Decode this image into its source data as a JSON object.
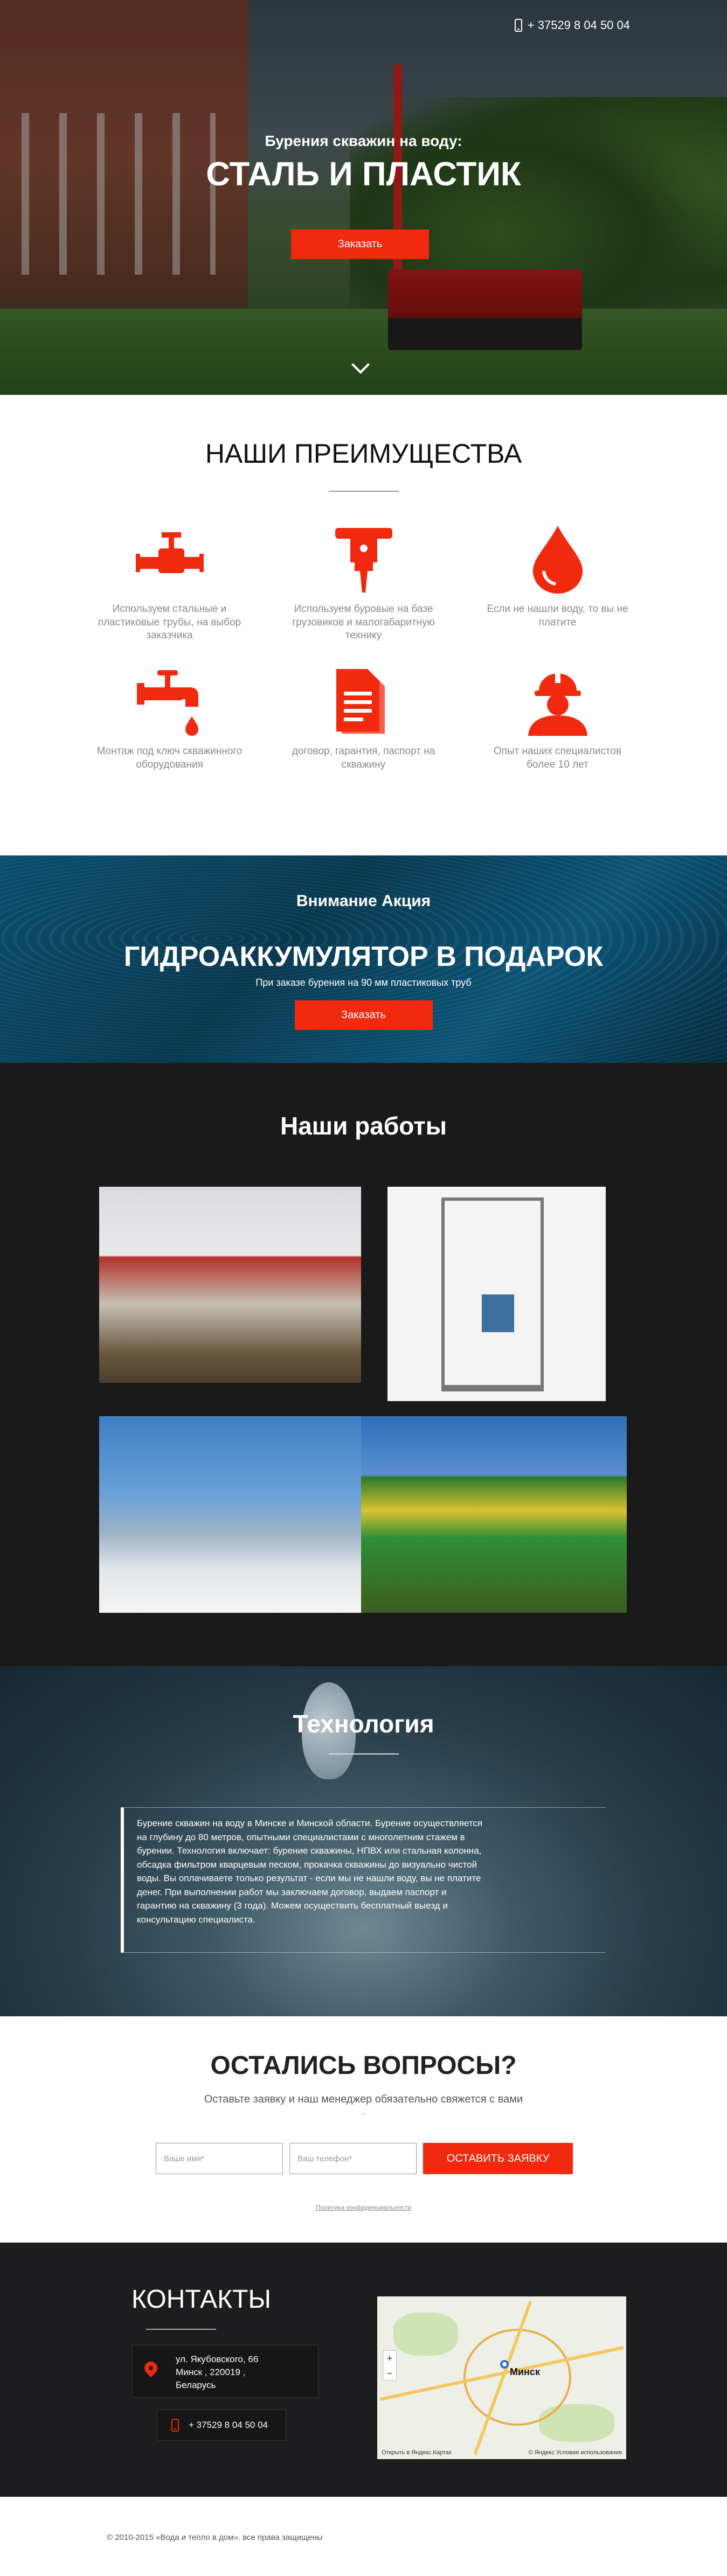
{
  "hero": {
    "phone": "+ 37529 8 04 50 04",
    "subtitle": "Бурения скважин на воду:",
    "title": "СТАЛЬ И ПЛАСТИК",
    "button": "Заказать"
  },
  "advantages": {
    "title": "НАШИ ПРЕИМУЩЕСТВА",
    "accent_color": "#f0290f",
    "items": [
      {
        "icon": "valve-icon",
        "text": "Используем стальные и пластиковые трубы, на выбор заказчика"
      },
      {
        "icon": "jackhammer-icon",
        "text": "Используем буровые на базе грузовиков и малогабаритную технику"
      },
      {
        "icon": "water-drop-icon",
        "text": "Если не нашли воду, то вы не платите"
      },
      {
        "icon": "faucet-icon",
        "text": "Монтаж под ключ скважинного оборудования"
      },
      {
        "icon": "document-icon",
        "text": "договор, гарантия, паспорт на скважину"
      },
      {
        "icon": "worker-icon",
        "text": "Опыт наших специалистов более 10 лет"
      }
    ]
  },
  "promo": {
    "label": "Внимание Акция",
    "title": "ГИДРОАККУМУЛЯТОР В ПОДАРОК",
    "text": "При заказе бурения на 90 мм пластиковых труб",
    "button": "Заказать"
  },
  "works": {
    "title": "Наши работы"
  },
  "technology": {
    "title": "Технология",
    "text": "Бурение скважин на воду в Минске и Минской области. Бурение осуществляется на глубину до 80 метров, опытными специалистами с многолетним стажем в бурении. Технология включает: бурение скважины, НПВХ или стальная колонна, обсадка фильтром кварцевым песком, прокачка скважины до визуально чистой воды. Вы оплачиваете только результат - если мы не нашли воду, вы не платите денег. При выполнении работ мы заключаем договор, выдаем паспорт и гарантию на скважину (3 года). Можем осуществить бесплатный выезд и консультацию специалиста."
  },
  "questions": {
    "title": "ОСТАЛИСЬ ВОПРОСЫ?",
    "subtitle": "Оставьте заявку и наш менеджер обязательно свяжется с вами",
    "dash": "-",
    "name_placeholder": "Ваше имя*",
    "phone_placeholder": "Ваш телефон*",
    "button": "ОСТАВИТЬ ЗАЯВКУ",
    "policy": "Политика конфиденциальности"
  },
  "contacts": {
    "title": "КОНТАКТЫ",
    "address_line1": "ул. Якубовского, 66",
    "address_line2": "Минск , 220019 ,",
    "address_line3": "Беларусь",
    "phone": "+ 37529 8 04 50 04",
    "map_city": "Минск",
    "map_zoom_in": "+",
    "map_zoom_out": "−",
    "map_footer_left": "Открыть в Яндекс.Картах",
    "map_footer_right": "© Яндекс  Условия использования"
  },
  "footer": {
    "copyright": "© 2010-2015 «Вода и тепло в дом». все права защищены"
  }
}
